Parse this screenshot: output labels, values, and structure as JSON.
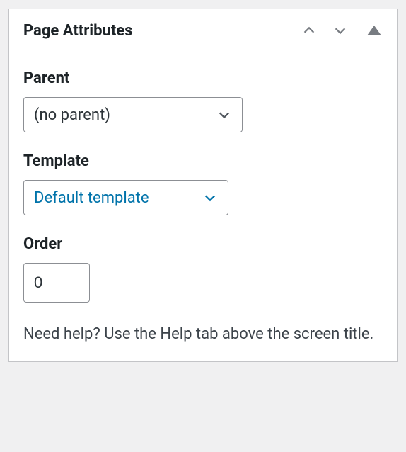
{
  "panel": {
    "title": "Page Attributes"
  },
  "fields": {
    "parent": {
      "label": "Parent",
      "value": "(no parent)"
    },
    "template": {
      "label": "Template",
      "value": "Default template"
    },
    "order": {
      "label": "Order",
      "value": "0"
    }
  },
  "help": "Need help? Use the Help tab above the screen title."
}
